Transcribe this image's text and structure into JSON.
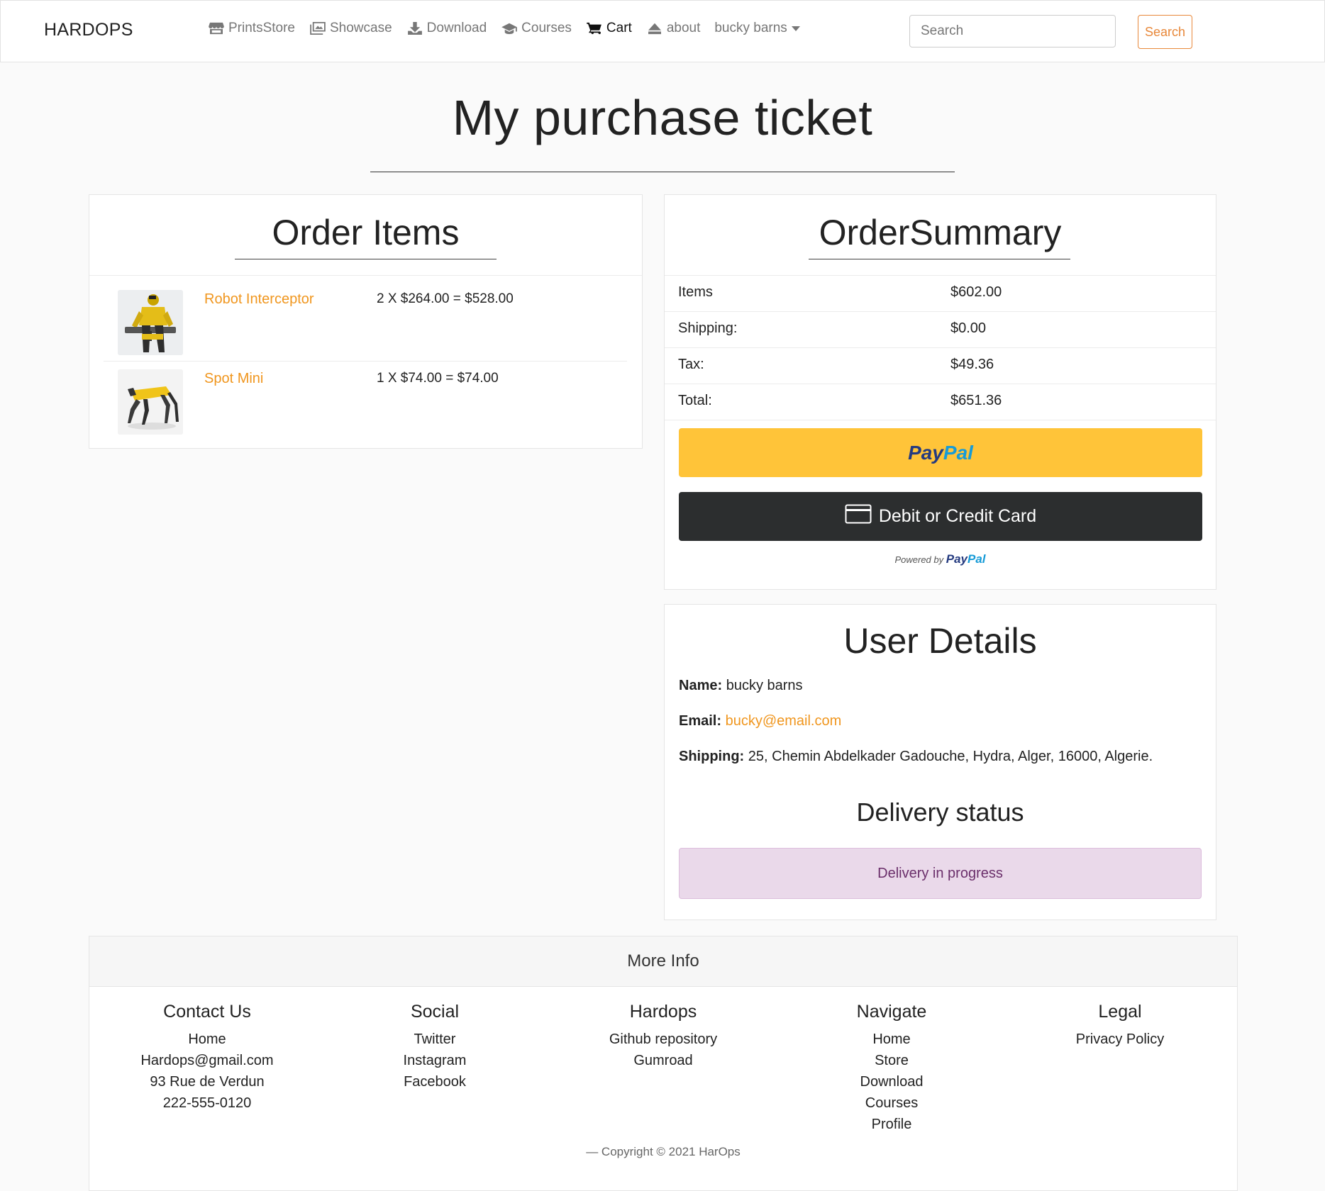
{
  "navbar": {
    "brand": "HARDOPS",
    "items": [
      {
        "label": "PrintsStore",
        "icon": "store-icon"
      },
      {
        "label": "Showcase",
        "icon": "images-icon"
      },
      {
        "label": "Download",
        "icon": "download-icon"
      },
      {
        "label": "Courses",
        "icon": "graduation-cap-icon"
      },
      {
        "label": "Cart",
        "icon": "cart-icon"
      },
      {
        "label": "about",
        "icon": "eject-icon"
      }
    ],
    "user_menu": "bucky barns",
    "search_placeholder": "Search",
    "search_button": "Search"
  },
  "page": {
    "title": "My purchase ticket"
  },
  "order_items": {
    "title": "Order Items",
    "items": [
      {
        "name": "Robot Interceptor",
        "price_line": "2 X $264.00 = $528.00"
      },
      {
        "name": "Spot Mini",
        "price_line": "1 X $74.00 = $74.00"
      }
    ]
  },
  "order_summary": {
    "title": "OrderSummary",
    "rows": [
      {
        "label": "Items",
        "value": "$602.00"
      },
      {
        "label": "Shipping:",
        "value": "$0.00"
      },
      {
        "label": "Tax:",
        "value": "$49.36"
      },
      {
        "label": "Total:",
        "value": "$651.36"
      }
    ],
    "paypal": {
      "part1": "Pay",
      "part2": "Pal"
    },
    "card_button": "Debit or Credit Card",
    "powered_by": "Powered by",
    "powered_brand": {
      "part1": "Pay",
      "part2": "Pal"
    }
  },
  "user_details": {
    "title": "User Details",
    "name_label": "Name:",
    "name": "bucky barns",
    "email_label": "Email:",
    "email": "bucky@email.com",
    "shipping_label": "Shipping:",
    "shipping": "25, Chemin Abdelkader Gadouche, Hydra, Alger, 16000, Algerie.",
    "delivery_title": "Delivery status",
    "delivery_status": "Delivery in progress"
  },
  "footer": {
    "title": "More Info",
    "columns": [
      {
        "heading": "Contact Us",
        "links": [
          "Home",
          "Hardops@gmail.com",
          "93 Rue de Verdun",
          "222-555-0120"
        ]
      },
      {
        "heading": "Social",
        "links": [
          "Twitter",
          "Instagram",
          "Facebook"
        ]
      },
      {
        "heading": "Hardops",
        "links": [
          "Github repository",
          "Gumroad"
        ]
      },
      {
        "heading": "Navigate",
        "links": [
          "Home",
          "Store",
          "Download",
          "Courses",
          "Profile"
        ]
      },
      {
        "heading": "Legal",
        "links": [
          "Privacy Policy"
        ]
      }
    ],
    "copyright": "— Copyright © 2021 HarOps"
  },
  "colors": {
    "accent_orange": "#f0961e",
    "paypal_yellow": "#ffc439",
    "card_button_dark": "#2c2e2f",
    "delivery_badge_bg": "#ead9ea"
  }
}
